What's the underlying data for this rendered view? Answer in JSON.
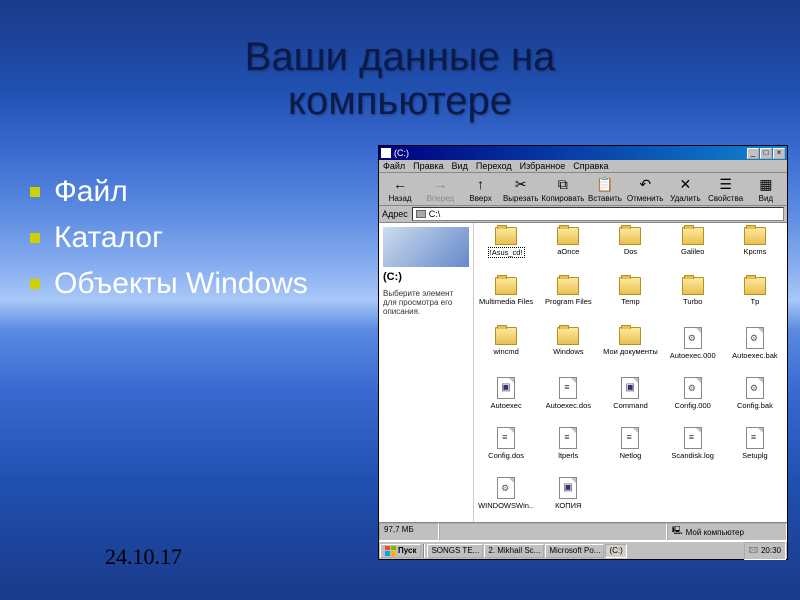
{
  "slide": {
    "title_line1": "Ваши данные на",
    "title_line2": "компьютере",
    "bullets": [
      "Файл",
      "Каталог",
      "Объекты Windows"
    ],
    "date": "24.10.17"
  },
  "explorer": {
    "title": "(C:)",
    "menus": [
      "Файл",
      "Правка",
      "Вид",
      "Переход",
      "Избранное",
      "Справка"
    ],
    "toolbar": [
      {
        "label": "Назад",
        "icon": "←",
        "disabled": false
      },
      {
        "label": "Вперед",
        "icon": "→",
        "disabled": true
      },
      {
        "label": "Вверх",
        "icon": "↑",
        "disabled": false
      },
      {
        "label": "Вырезать",
        "icon": "✂",
        "disabled": false
      },
      {
        "label": "Копировать",
        "icon": "⧉",
        "disabled": false
      },
      {
        "label": "Вставить",
        "icon": "📋",
        "disabled": false
      },
      {
        "label": "Отменить",
        "icon": "↶",
        "disabled": false
      },
      {
        "label": "Удалить",
        "icon": "✕",
        "disabled": false
      },
      {
        "label": "Свойства",
        "icon": "☰",
        "disabled": false
      },
      {
        "label": "Вид",
        "icon": "▦",
        "disabled": false
      }
    ],
    "address_label": "Адрес",
    "address_value": "C:\\",
    "leftpane": {
      "title": "(C:)",
      "desc": "Выберите элемент для просмотра его описания."
    },
    "files": [
      {
        "name": "!Asus_cd!",
        "type": "folder",
        "selected": true
      },
      {
        "name": "aOnce",
        "type": "folder"
      },
      {
        "name": "Dos",
        "type": "folder"
      },
      {
        "name": "Galileo",
        "type": "folder"
      },
      {
        "name": "Kpcms",
        "type": "folder"
      },
      {
        "name": "Multimedia Files",
        "type": "folder"
      },
      {
        "name": "Program Files",
        "type": "folder"
      },
      {
        "name": "Temp",
        "type": "folder"
      },
      {
        "name": "Turbo",
        "type": "folder"
      },
      {
        "name": "Tp",
        "type": "folder"
      },
      {
        "name": "wincmd",
        "type": "folder"
      },
      {
        "name": "Windows",
        "type": "folder"
      },
      {
        "name": "Мои документы",
        "type": "folder"
      },
      {
        "name": "Autoexec.000",
        "type": "sys"
      },
      {
        "name": "Autoexec.bak",
        "type": "sys"
      },
      {
        "name": "Autoexec",
        "type": "dos"
      },
      {
        "name": "Autoexec.dos",
        "type": "bat"
      },
      {
        "name": "Command",
        "type": "dos"
      },
      {
        "name": "Config.000",
        "type": "sys"
      },
      {
        "name": "Config.bak",
        "type": "sys"
      },
      {
        "name": "Config.dos",
        "type": "bat"
      },
      {
        "name": "ltperls",
        "type": "bat"
      },
      {
        "name": "Netlog",
        "type": "bat"
      },
      {
        "name": "Scandisk.log",
        "type": "bat"
      },
      {
        "name": "Setuplg",
        "type": "bat"
      },
      {
        "name": "WINDOWSWin...",
        "type": "sys"
      },
      {
        "name": "КОПИЯ",
        "type": "dos"
      }
    ],
    "status": {
      "size": "97,7 МБ",
      "empty": "",
      "location": "Мой компьютер"
    },
    "taskbar": {
      "start": "Пуск",
      "tasks": [
        {
          "label": "SONGS TE..."
        },
        {
          "label": "2. Mikhail Sc..."
        },
        {
          "label": "Microsoft Po..."
        },
        {
          "label": "(C:)",
          "active": true
        }
      ],
      "clock": "20:30"
    }
  }
}
